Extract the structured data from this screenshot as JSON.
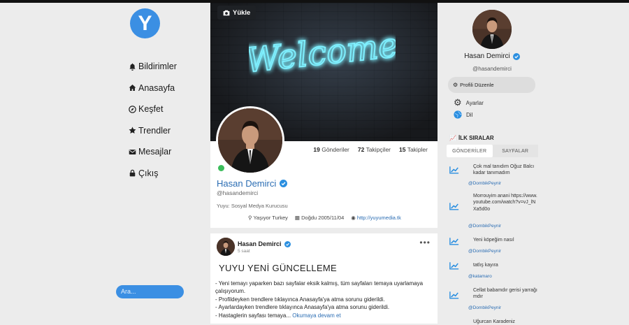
{
  "brand": {
    "logo_letter": "Y",
    "accent": "#3b8fe3"
  },
  "nav": [
    {
      "icon": "bell-icon",
      "label": "Bildirimler"
    },
    {
      "icon": "home-icon",
      "label": "Anasayfa"
    },
    {
      "icon": "compass-icon",
      "label": "Keşfet"
    },
    {
      "icon": "star-icon",
      "label": "Trendler"
    },
    {
      "icon": "envelope-icon",
      "label": "Mesajlar"
    },
    {
      "icon": "lock-icon",
      "label": "Çıkış"
    }
  ],
  "search": {
    "placeholder": "Ara..."
  },
  "cover": {
    "upload_label": "Yükle",
    "neon_text": "Welcome"
  },
  "profile": {
    "stats": [
      {
        "count": "19",
        "label": "Gönderiler"
      },
      {
        "count": "72",
        "label": "Takipçiler"
      },
      {
        "count": "15",
        "label": "Takipler"
      }
    ],
    "name": "Hasan Demirci",
    "handle": "@hasandemirci",
    "bio": "Yuyu: Sosyal Medya Kurucusu",
    "location": "Yaşıyor Turkey",
    "birthday": "Doğdu 2005/11/04",
    "website": "http://yuyumedia.tk"
  },
  "post": {
    "author": "Hasan Demirci",
    "time": "5 saat",
    "title": "YUYU YENİ GÜNCELLEME",
    "lines": [
      "- Yeni temayı yaparken bazı sayfalar eksik kalmış, tüm sayfaları temaya uyarlamaya",
      "çalışıyorum.",
      "- Profildeyken trendlere tıklayınca Anasayfa'ya atma sorunu giderildi.",
      "- Ayarlardayken trendlere tıklayınca Anasayfa'ya atma sorunu giderildi.",
      "- Hastaglerin sayfası temaya..."
    ],
    "read_more": "Okumaya devam et"
  },
  "sidebar_right": {
    "name": "Hasan Demirci",
    "handle": "@hasandemirci",
    "edit_profile": "Profili Düzenle",
    "settings": "Ayarlar",
    "language": "Dil",
    "section_title": "İLK SIRALAR",
    "tabs": [
      "GÖNDERİLER",
      "SAYFALAR"
    ],
    "trends": [
      {
        "text": "Çok mal tanıdım Oğuz Balcı kadar tanımadım",
        "user": "@DombikPeynir"
      },
      {
        "text": "Morrouyim anani https://www.youtube.com/watch?v=vJ_lNXa5d0o",
        "user": "@DombikPeynir"
      },
      {
        "text": "Yeni köpeğim nasıl",
        "user": "@DombikPeynir"
      },
      {
        "text": "tatlış kayıra",
        "user": "@katamaro"
      },
      {
        "text": "Cellat babamdır gerisi yarrağımdır",
        "user": "@DombikPeynir"
      },
      {
        "text": "Uğurcan Karadeniz",
        "user": ""
      }
    ]
  },
  "colors": {
    "accent": "#3b8fe3",
    "link": "#2b6db3",
    "verified": "#2b8fe0",
    "online": "#3bbd5b"
  }
}
